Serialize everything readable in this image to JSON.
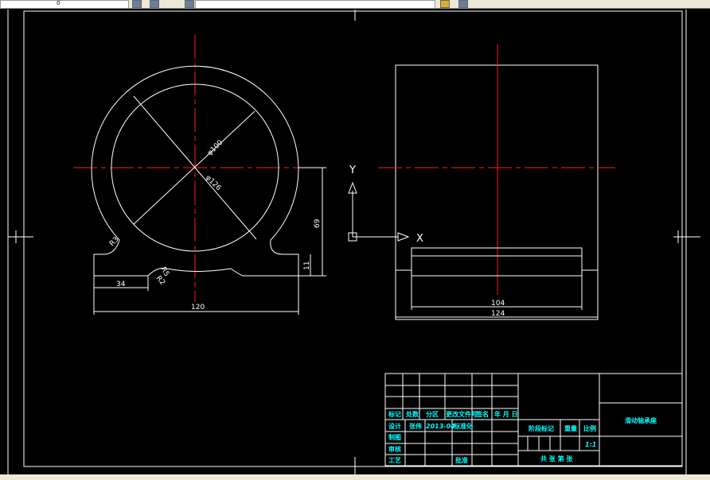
{
  "toolbar": {
    "layer_field": "0"
  },
  "left_view": {
    "dims": {
      "d_inner": "φ100",
      "d_outer": "φ126",
      "height": "69",
      "base_thickness": "11",
      "foot_width": "34",
      "total_width": "120",
      "r_top": "R3",
      "r_fillet1": "R5",
      "r_fillet2": "R2"
    }
  },
  "ucs": {
    "y_label": "Y",
    "x_label": "X"
  },
  "right_view": {
    "dims": {
      "inner_length": "104",
      "total_length": "124"
    }
  },
  "title_block": {
    "header": [
      "标记",
      "处数",
      "分区",
      "更改文件号",
      "签名",
      "年 月 日"
    ],
    "design_label": "设计",
    "designer": "张伟",
    "date": "2013-04",
    "standard_label": "标准化",
    "drawing_label": "制图",
    "review_label": "审核",
    "process_label": "工艺",
    "approve_label": "批准",
    "stage_label": "阶段标记",
    "weight_label": "重量",
    "scale_label": "比例",
    "scale_value": "1:1",
    "sheets": "共  张  第  张",
    "part_name": "滑动轴承座"
  },
  "colors": {
    "accent_red": "#ff1a1a",
    "text_cyan": "#00ffff"
  }
}
